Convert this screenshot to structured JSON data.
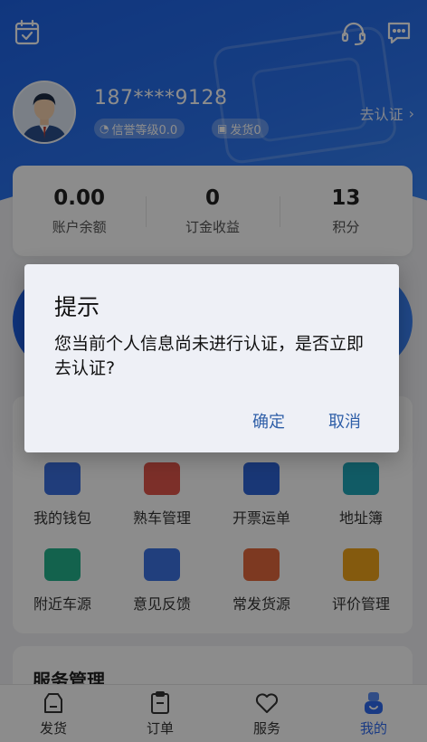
{
  "header": {
    "phone": "187****9128",
    "badges": {
      "credit": "信誉等级0.0",
      "shipments": "发货0"
    },
    "certify_link": "去认证"
  },
  "stats": [
    {
      "value": "0.00",
      "label": "账户余额"
    },
    {
      "value": "0",
      "label": "订金收益"
    },
    {
      "value": "13",
      "label": "积分"
    }
  ],
  "menu": [
    {
      "label": "我的钱包",
      "icon": "wallet-icon",
      "color": "#3b6fe0"
    },
    {
      "label": "熟车管理",
      "icon": "truck-icon",
      "color": "#e2574c"
    },
    {
      "label": "开票运单",
      "icon": "ticket-icon",
      "color": "#2f64d8"
    },
    {
      "label": "地址簿",
      "icon": "location-book-icon",
      "color": "#1fa6b9"
    },
    {
      "label": "附近车源",
      "icon": "nearby-truck-icon",
      "color": "#23b38d"
    },
    {
      "label": "意见反馈",
      "icon": "feedback-icon",
      "color": "#3d74e4"
    },
    {
      "label": "常发货源",
      "icon": "cargo-box-icon",
      "color": "#e4683c"
    },
    {
      "label": "评价管理",
      "icon": "review-icon",
      "color": "#f0a51b"
    }
  ],
  "service": {
    "title": "服务管理"
  },
  "tabbar": [
    {
      "label": "发货",
      "icon": "ship-icon",
      "active": false
    },
    {
      "label": "订单",
      "icon": "order-icon",
      "active": false
    },
    {
      "label": "服务",
      "icon": "heart-icon",
      "active": false
    },
    {
      "label": "我的",
      "icon": "profile-icon",
      "active": true
    }
  ],
  "dialog": {
    "title": "提示",
    "message": "您当前个人信息尚未进行认证，是否立即去认证?",
    "confirm": "确定",
    "cancel": "取消"
  },
  "colors": {
    "primary": "#2a6ef0",
    "active_tab": "#2f6bf0",
    "dialog_button": "#2f5fa8"
  }
}
